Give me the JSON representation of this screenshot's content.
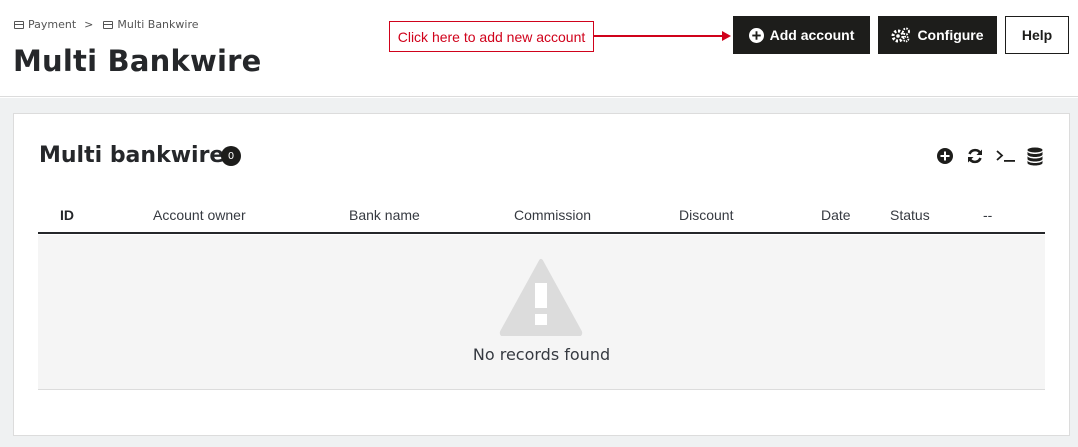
{
  "breadcrumb": {
    "items": [
      "Payment",
      "Multi Bankwire"
    ],
    "separator": ">"
  },
  "header": {
    "title": "Multi Bankwire",
    "callout": "Click here to add new account",
    "buttons": {
      "add": "Add account",
      "configure": "Configure",
      "help": "Help"
    }
  },
  "panel": {
    "title": "Multi bankwire",
    "count": "0",
    "columns": [
      "ID",
      "Account owner",
      "Bank name",
      "Commission",
      "Discount",
      "Date",
      "Status",
      "--"
    ],
    "empty_text": "No records found"
  },
  "colors": {
    "dark": "#1d1d1b",
    "callout": "#d0021b",
    "background": "#eff1f2",
    "empty_bg": "#f5f5f5",
    "warning_icon": "#dcdcdc"
  },
  "icons": [
    "add-circle-icon",
    "gears-icon",
    "refresh-icon",
    "terminal-icon",
    "database-icon",
    "warning-icon",
    "credit-card-icon"
  ]
}
